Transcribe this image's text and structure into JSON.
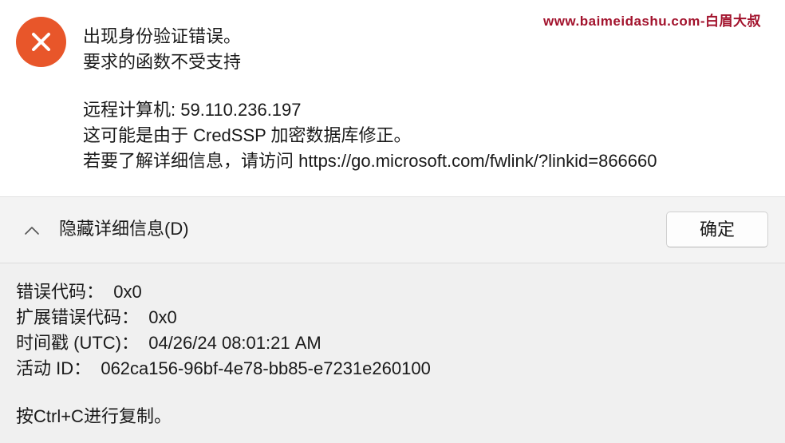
{
  "watermark": "www.baimeidashu.com-白眉大叔",
  "message": {
    "line1": "出现身份验证错误。",
    "line2": "要求的函数不受支持",
    "line3": "远程计算机: 59.110.236.197",
    "line4": "这可能是由于 CredSSP 加密数据库修正。",
    "line5": "若要了解详细信息，请访问 https://go.microsoft.com/fwlink/?linkid=866660"
  },
  "toggle_label": "隐藏详细信息(D)",
  "ok_label": "确定",
  "details": {
    "line1": "错误代码：  0x0",
    "line2": "扩展错误代码：  0x0",
    "line3": "时间戳 (UTC)：  04/26/24 08:01:21 AM",
    "line4": "活动 ID：  062ca156-96bf-4e78-bb85-e7231e260100",
    "line5": "按Ctrl+C进行复制。"
  },
  "colors": {
    "error_icon": "#e8562a",
    "watermark": "#a2122c"
  },
  "icons": {
    "error": "error-x-icon",
    "chevron": "chevron-up-icon"
  }
}
